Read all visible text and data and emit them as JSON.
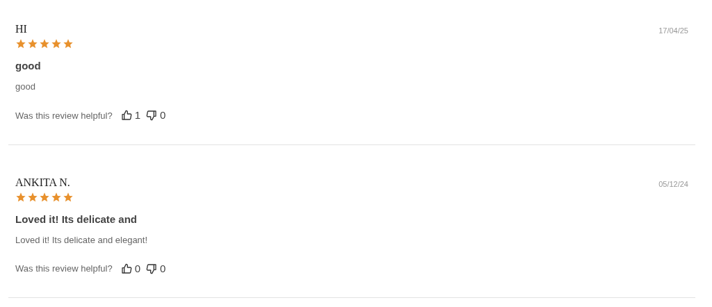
{
  "reviews": [
    {
      "author": "HI",
      "date": "17/04/25",
      "stars": 5,
      "title": "good",
      "body": "good",
      "helpful_label": "Was this review helpful?",
      "upvotes": "1",
      "downvotes": "0"
    },
    {
      "author": "ANKITA N.",
      "date": "05/12/24",
      "stars": 5,
      "title": "Loved it! Its delicate and",
      "body": "Loved it! Its delicate and elegant!",
      "helpful_label": "Was this review helpful?",
      "upvotes": "0",
      "downvotes": "0"
    }
  ]
}
